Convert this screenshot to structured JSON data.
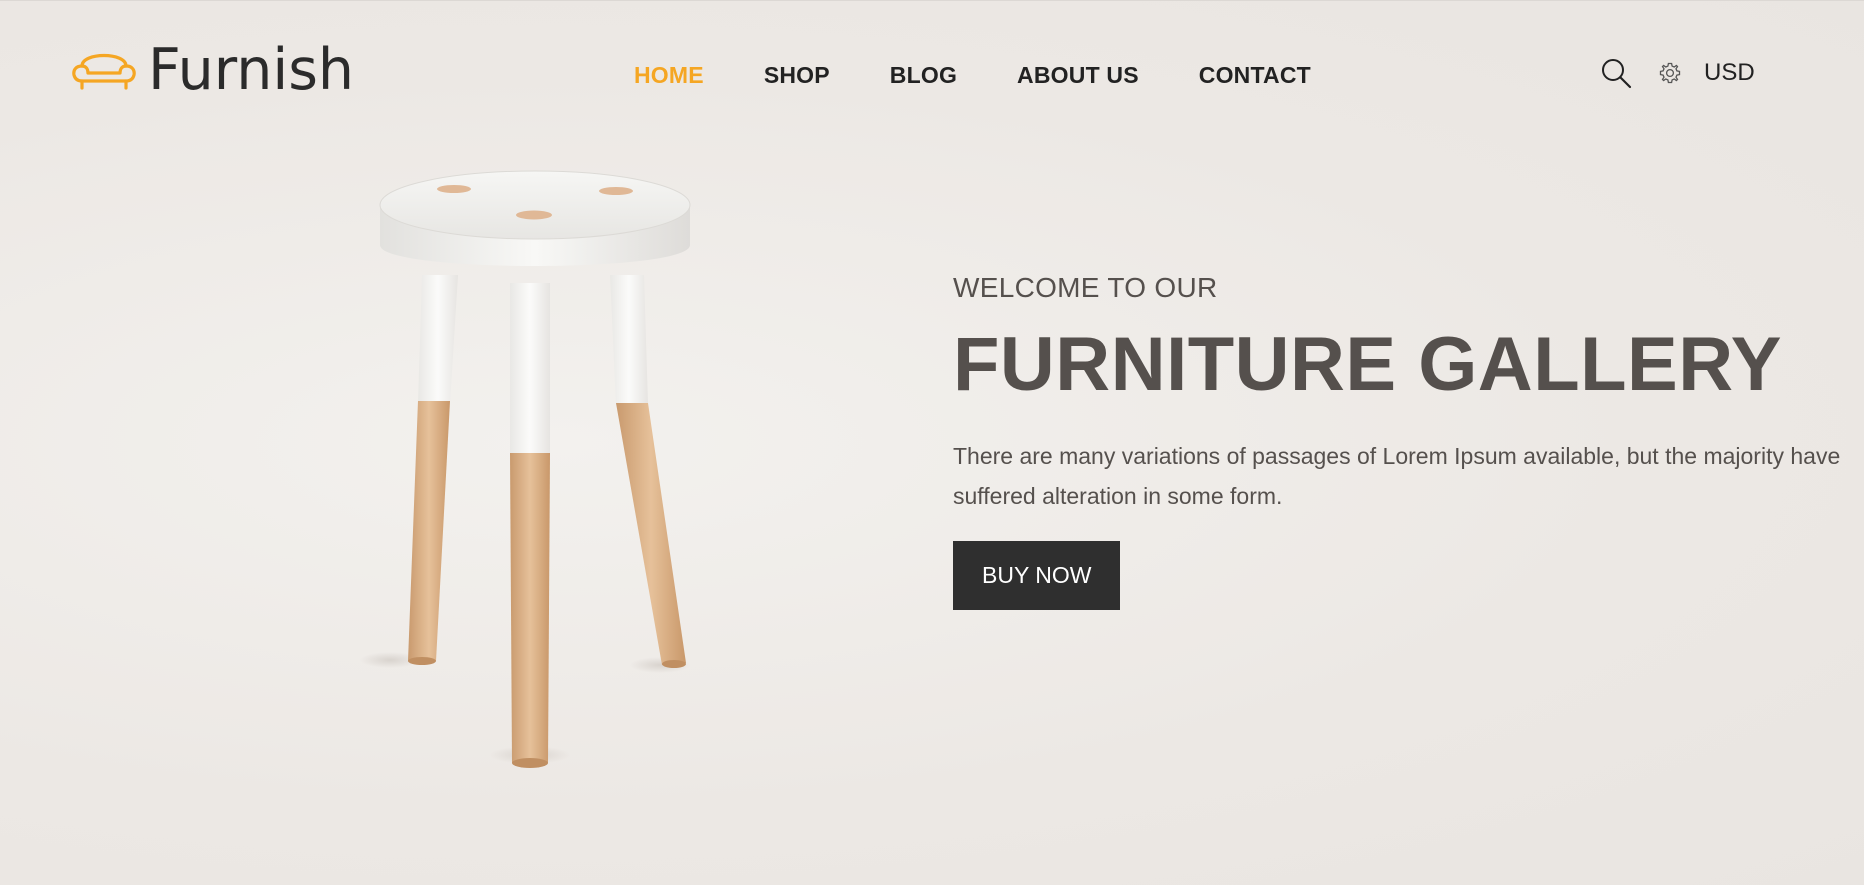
{
  "brand": {
    "name": "Furnish",
    "icon": "sofa-icon",
    "accent_color": "#f5a623"
  },
  "nav": {
    "items": [
      {
        "label": "HOME",
        "active": true
      },
      {
        "label": "SHOP",
        "active": false
      },
      {
        "label": "BLOG",
        "active": false
      },
      {
        "label": "ABOUT US",
        "active": false
      },
      {
        "label": "CONTACT",
        "active": false
      }
    ]
  },
  "header_tools": {
    "search_icon": "search-icon",
    "settings_icon": "gear-icon",
    "currency": "USD"
  },
  "hero": {
    "subtitle": "WELCOME TO OUR",
    "title": "FURNITURE GALLERY",
    "description": "There are many variations of passages of Lorem Ipsum available, but the majority have suffered alteration in some form.",
    "button_label": "BUY NOW",
    "button_color": "#2f2f2f",
    "text_color": "#55504d",
    "image": "stool-image"
  }
}
